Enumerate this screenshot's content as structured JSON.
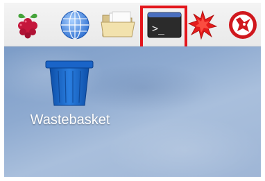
{
  "taskbar": {
    "launchers": [
      {
        "icon": "raspberry-pi-menu-icon"
      },
      {
        "icon": "web-browser-globe-icon"
      },
      {
        "icon": "file-manager-folder-icon"
      },
      {
        "icon": "terminal-icon",
        "glyph": ">_",
        "highlighted": true
      },
      {
        "icon": "mathematica-icon"
      },
      {
        "icon": "wolfram-icon"
      }
    ]
  },
  "desktop": {
    "items": [
      {
        "label": "Wastebasket",
        "icon": "wastebasket-icon"
      }
    ]
  },
  "colors": {
    "highlight": "#e3161c",
    "terminal_bg": "#2b2b2b",
    "terminal_bar": "#4a6fbf",
    "wastebasket": "#1a64c8",
    "mathematica": "#e41b1b",
    "wolfram": "#d0181e"
  }
}
